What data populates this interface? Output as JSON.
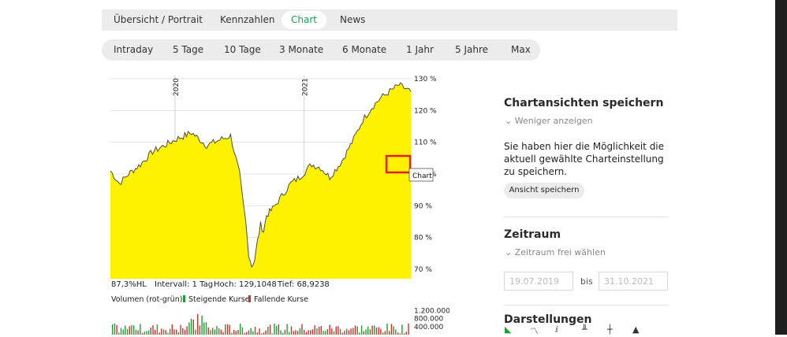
{
  "tabs": [
    {
      "label": "Übersicht / Portrait",
      "active": false
    },
    {
      "label": "Kennzahlen",
      "active": false
    },
    {
      "label": "Chart",
      "active": true
    },
    {
      "label": "News",
      "active": false
    }
  ],
  "ranges": [
    "Intraday",
    "5 Tage",
    "10 Tage",
    "3 Monate",
    "6 Monate",
    "1 Jahr",
    "5 Jahre",
    "Max"
  ],
  "chart": {
    "stats": {
      "hl": "87,3%HL",
      "interval": "Intervall: 1 Tag",
      "high": "Hoch: 129,1048",
      "low": "Tief: 68,9238"
    },
    "legend": {
      "volume": "Volumen (rot-grün)",
      "rising": "Steigende Kurse",
      "falling": "Fallende Kurse"
    },
    "tooltip": "Chart",
    "colors": {
      "fill": "#fff200",
      "line": "#4a4a4a",
      "up": "#1e9e34",
      "down": "#c83232",
      "highlight": "#e01c1c"
    }
  },
  "chart_data": [
    {
      "type": "area",
      "x_ticks": [
        "2020",
        "2021"
      ],
      "y_ticks": [
        "130 %",
        "120 %",
        "110 %",
        "100 %",
        "90 %",
        "80 %",
        "70 %"
      ],
      "ylim": [
        67,
        131
      ],
      "grid": true,
      "series": [
        {
          "x": [
            0,
            3,
            6,
            10,
            14,
            18,
            22,
            27,
            32,
            37,
            40,
            43,
            44,
            45,
            46,
            47,
            48,
            49,
            50,
            51,
            52,
            54,
            57,
            60,
            63,
            67,
            70,
            73,
            77,
            81,
            84,
            87,
            90,
            93,
            96,
            100
          ],
          "y": [
            101,
            97,
            100,
            103,
            107,
            109,
            111,
            113,
            109,
            111,
            112,
            100,
            92,
            85,
            75,
            71,
            73,
            79,
            84,
            82,
            87,
            89,
            93,
            97,
            99,
            103,
            102,
            99,
            104,
            111,
            117,
            121,
            124,
            126,
            128,
            126
          ]
        }
      ]
    },
    {
      "type": "bar",
      "y_ticks": [
        "1.200.000",
        "800.000",
        "400.000"
      ],
      "ylim": [
        0,
        1300000
      ]
    }
  ],
  "sidebar": {
    "save": {
      "title": "Chartansichten speichern",
      "toggle": "Weniger anzeigen",
      "text": "Sie haben hier die Möglichkeit die aktuell gewählte Charteinstellung zu speichern.",
      "button": "Ansicht speichern"
    },
    "period": {
      "title": "Zeitraum",
      "toggle": "Zeitraum frei wählen",
      "from": "19.07.2019",
      "bis": "bis",
      "to": "31.10.2021"
    },
    "display": {
      "title": "Darstellungen"
    }
  }
}
